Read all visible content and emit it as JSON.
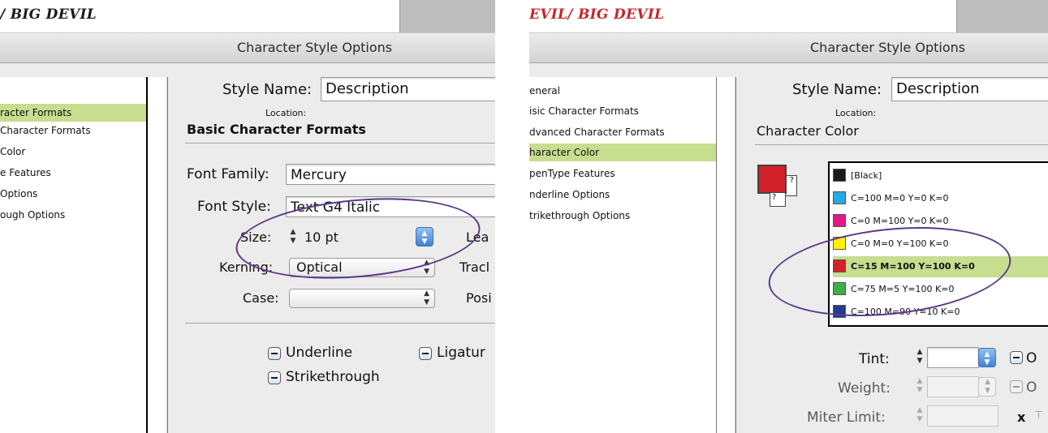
{
  "left": {
    "document_title": "/ BIG DEVIL",
    "window_title": "Character Style Options",
    "sidebar_items": [
      {
        "label": "racter Formats",
        "selected": true
      },
      {
        "label": " Character Formats",
        "selected": false
      },
      {
        "label": " Color",
        "selected": false
      },
      {
        "label": "e Features",
        "selected": false
      },
      {
        "label": " Options",
        "selected": false
      },
      {
        "label": "ough Options",
        "selected": false
      }
    ],
    "style_name_label": "Style Name:",
    "style_name_value": "Description",
    "location_label": "Location:",
    "section_title": "Basic Character Formats",
    "font_family_label": "Font Family:",
    "font_family_value": "Mercury",
    "font_style_label": "Font Style:",
    "font_style_value": "Text G4 Italic",
    "size_label": "Size:",
    "size_value": "10 pt",
    "leading_label": "Lea",
    "kerning_label": "Kerning:",
    "kerning_value": "Optical",
    "tracking_label": "Tracl",
    "case_label": "Case:",
    "case_value": "",
    "position_label": "Posi",
    "underline_label": "Underline",
    "ligatures_label": "Ligatur",
    "strikethrough_label": "Strikethrough"
  },
  "right": {
    "document_title": "EVIL/ BIG DEVIL",
    "window_title": "Character Style Options",
    "sidebar_items": [
      {
        "label": "eneral",
        "selected": false
      },
      {
        "label": "isic Character Formats",
        "selected": false
      },
      {
        "label": "dvanced Character Formats",
        "selected": false
      },
      {
        "label": "haracter Color",
        "selected": true
      },
      {
        "label": "penType Features",
        "selected": false
      },
      {
        "label": "nderline Options",
        "selected": false
      },
      {
        "label": "trikethrough Options",
        "selected": false
      }
    ],
    "style_name_label": "Style Name:",
    "style_name_value": "Description",
    "location_label": "Location:",
    "section_title": "Character Color",
    "swatches": [
      {
        "label": "[Black]",
        "color": "#1a1a1a",
        "selected": false
      },
      {
        "label": "C=100 M=0 Y=0 K=0",
        "color": "#27a9e1",
        "selected": false
      },
      {
        "label": "C=0 M=100 Y=0 K=0",
        "color": "#e4168b",
        "selected": false
      },
      {
        "label": "C=0 M=0 Y=100 K=0",
        "color": "#fff200",
        "selected": false
      },
      {
        "label": "C=15 M=100 Y=100 K=0",
        "color": "#d32129",
        "selected": true
      },
      {
        "label": "C=75 M=5 Y=100 K=0",
        "color": "#3fae49",
        "selected": false
      },
      {
        "label": "C=100 M=90 Y=10 K=0",
        "color": "#233c8f",
        "selected": false
      }
    ],
    "fill_color": "#d32129",
    "stroke_unknown": "?",
    "tint_label": "Tint:",
    "tint_value": "",
    "overprint_fill_label": "O",
    "weight_label": "Weight:",
    "weight_value": "",
    "overprint_stroke_label": "O",
    "miter_label": "Miter Limit:",
    "miter_value": "",
    "miter_x": "x"
  },
  "colors": {
    "accent_selection": "#c7dd8f",
    "annotation_circle": "#5a3a86",
    "document_title_red": "#c8242b"
  }
}
